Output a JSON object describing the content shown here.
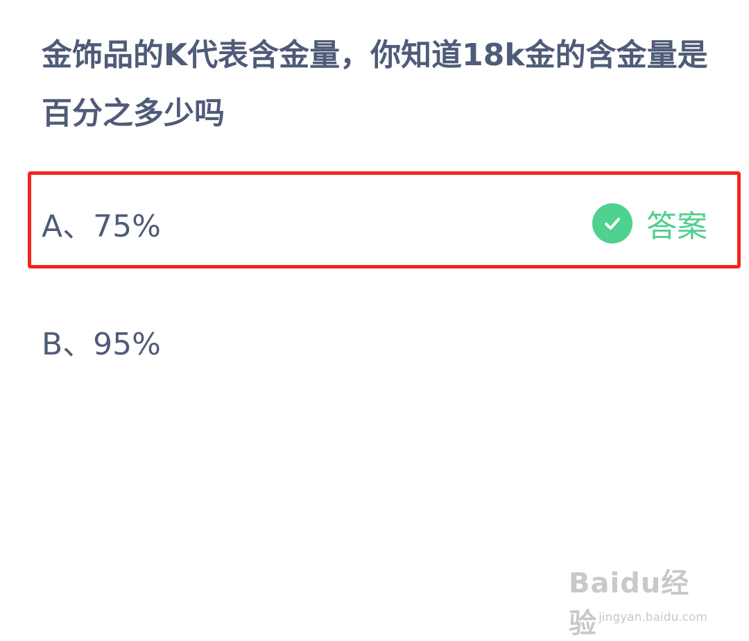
{
  "question": {
    "text": "金饰品的K代表含金量，你知道18k金的含金量是百分之多少吗"
  },
  "options": [
    {
      "label": "A、75%",
      "is_answer": true,
      "answer_tag": "答案"
    },
    {
      "label": "B、95%",
      "is_answer": false
    }
  ],
  "colors": {
    "question_text": "#4f5b78",
    "answer_green": "#4fd18f",
    "highlight_red": "#f2261f",
    "watermark_gray": "#c9c9c9"
  },
  "icons": {
    "answer_icon": "check-circle-icon"
  },
  "watermark": {
    "logo_text": "Baidu经验",
    "url": "jingyan.baidu.com"
  }
}
